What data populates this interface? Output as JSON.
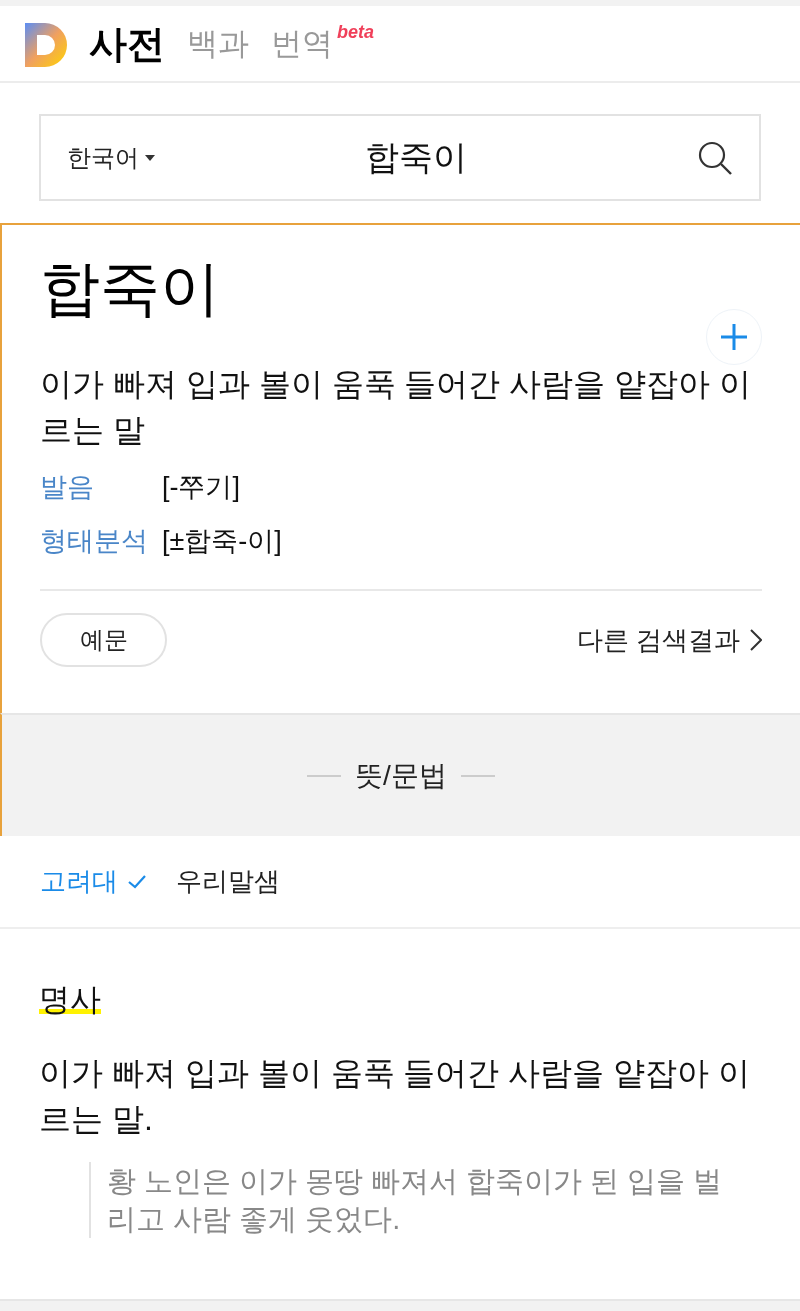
{
  "nav": {
    "tabs": [
      {
        "label": "사전",
        "selected": true
      },
      {
        "label": "백과",
        "selected": false
      },
      {
        "label": "번역",
        "selected": false,
        "badge": "beta"
      }
    ]
  },
  "search": {
    "language": "한국어",
    "value": "합죽이"
  },
  "entry": {
    "word": "합죽이",
    "summary": "이가 빠져 입과 볼이 움푹 들어간 사람을 얕잡아 이르는 말",
    "info": [
      {
        "label": "발음",
        "value": "[-쭈기]"
      },
      {
        "label": "형태분석",
        "value": "[±합죽-이]"
      }
    ],
    "examples_button": "예문",
    "other_results": "다른 검색결과"
  },
  "section_title": "뜻/문법",
  "dictionaries": [
    {
      "label": "고려대",
      "selected": true
    },
    {
      "label": "우리말샘",
      "selected": false
    }
  ],
  "meaning": {
    "part_of_speech": "명사",
    "definition": "이가 빠져 입과 볼이 움푹 들어간 사람을 얕잡아 이르는 말.",
    "example": "황 노인은 이가 몽땅 빠져서 합죽이가 된 입을 벌리고 사람 좋게 웃었다."
  }
}
